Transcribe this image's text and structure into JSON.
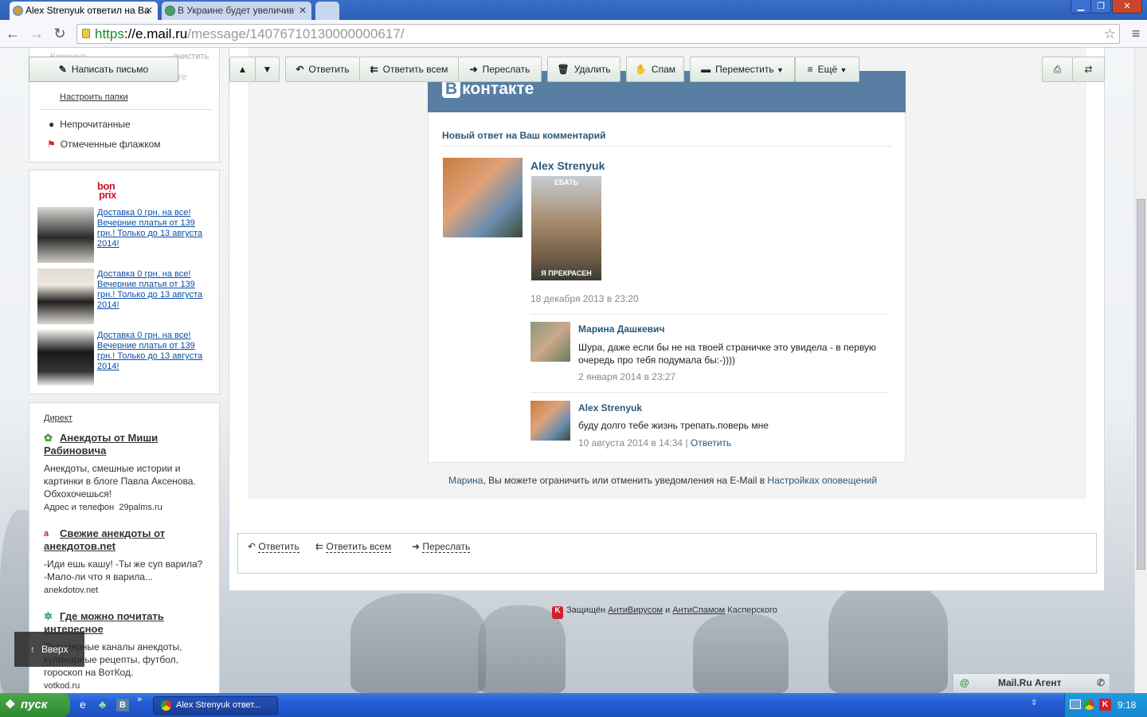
{
  "browser": {
    "tabs": [
      {
        "label": "Alex Strenyuk ответил на Ва"
      },
      {
        "label": "В Украине будет увеличив"
      }
    ],
    "url_scheme": "https",
    "url_host": "://e.mail.ru",
    "url_path": "/message/14076710130000000617/"
  },
  "sidebar": {
    "trash_label": "Корзина",
    "clear_label": "очистить",
    "agent_label": "Агенте",
    "compose_label": "Написать письмо",
    "configure_folders": "Настроить папки",
    "filters": [
      {
        "label": "Непрочитанные"
      },
      {
        "label": "Отмеченные флажком"
      }
    ]
  },
  "ads": {
    "brand_top": "bon",
    "brand_bottom": "prix",
    "items": [
      {
        "text": "Доставка 0 грн. на все! Вечерние платья от 139 грн.! Только до 13 августа 2014!"
      },
      {
        "text": "Доставка 0 грн. на все! Вечерние платья от 139 грн.! Только до 13 августа 2014!"
      },
      {
        "text": "Доставка 0 грн. на все! Вечерние платья от 139 грн.! Только до 13 августа 2014!"
      }
    ]
  },
  "direct": {
    "header": "Директ",
    "items": [
      {
        "title": "Анекдоты от Миши Рабиновича",
        "desc": "Анекдоты, смешные истории и картинки в блоге Павла Аксенова. Обхохочешься!",
        "extra": "Адрес и телефон",
        "site": "29palms.ru"
      },
      {
        "title": "Свежие анекдоты от анекдотов.net",
        "desc": "-Иди ешь кашу! -Ты же суп варила? -Мало-ли что я варила...",
        "site": "anekdotov.net"
      },
      {
        "title": "Где можно почитать интересное",
        "desc": "Популярные каналы анекдоты, кулинарные рецепты, футбол, гороскоп на ВотКод.",
        "site": "votkod.ru"
      }
    ],
    "up_label": "Вверх"
  },
  "toolbar": {
    "reply": "Ответить",
    "reply_all": "Ответить всем",
    "forward": "Переслать",
    "delete": "Удалить",
    "spam": "Спам",
    "move": "Переместить",
    "more": "Ещё"
  },
  "email": {
    "vk_logo": "контакте",
    "vk_logo_b": "В",
    "subtitle": "Новый ответ на Ваш комментарий",
    "post_author": "Alex Strenyuk",
    "meme_top": "ЕБАТЬ",
    "meme_bottom": "Я ПРЕКРАСЕН",
    "post_date": "18 декабря 2013 в 23:20",
    "comments": [
      {
        "author": "Марина Дашкевич",
        "text": "Шура, даже если бы не на твоей страничке это увидела - в первую очередь про тебя подумала бы:-))))",
        "date": "2 января 2014 в 23:27"
      },
      {
        "author": "Alex Strenyuk",
        "text": "буду долго тебе жизнь трепать.поверь мне",
        "date": "10 августа 2014 в 14:34",
        "sep": " | ",
        "action": "Ответить"
      }
    ],
    "footer_name": "Марина",
    "footer_text": ", Вы можете ограничить или отменить уведомления на E-Mail в ",
    "footer_link": "Настройках оповещений"
  },
  "quick_reply": {
    "reply": "Ответить",
    "reply_all": "Ответить всем",
    "forward": "Переслать"
  },
  "kaspersky": {
    "prefix": "Защищён ",
    "antivirus": "АнтиВирусом",
    "and": " и ",
    "antispam": "АнтиСпамом",
    "suffix": " Касперского"
  },
  "agent_widget": {
    "label": "Mail.Ru Агент"
  },
  "taskbar": {
    "start": "пуск",
    "window": "Alex Strenyuk ответ...",
    "time": "9:18"
  },
  "colors": {
    "vk_header": "#587ea3",
    "button_green": "#dfe8e1",
    "link": "#0a4fa6",
    "taskbar": "#245dd5"
  }
}
